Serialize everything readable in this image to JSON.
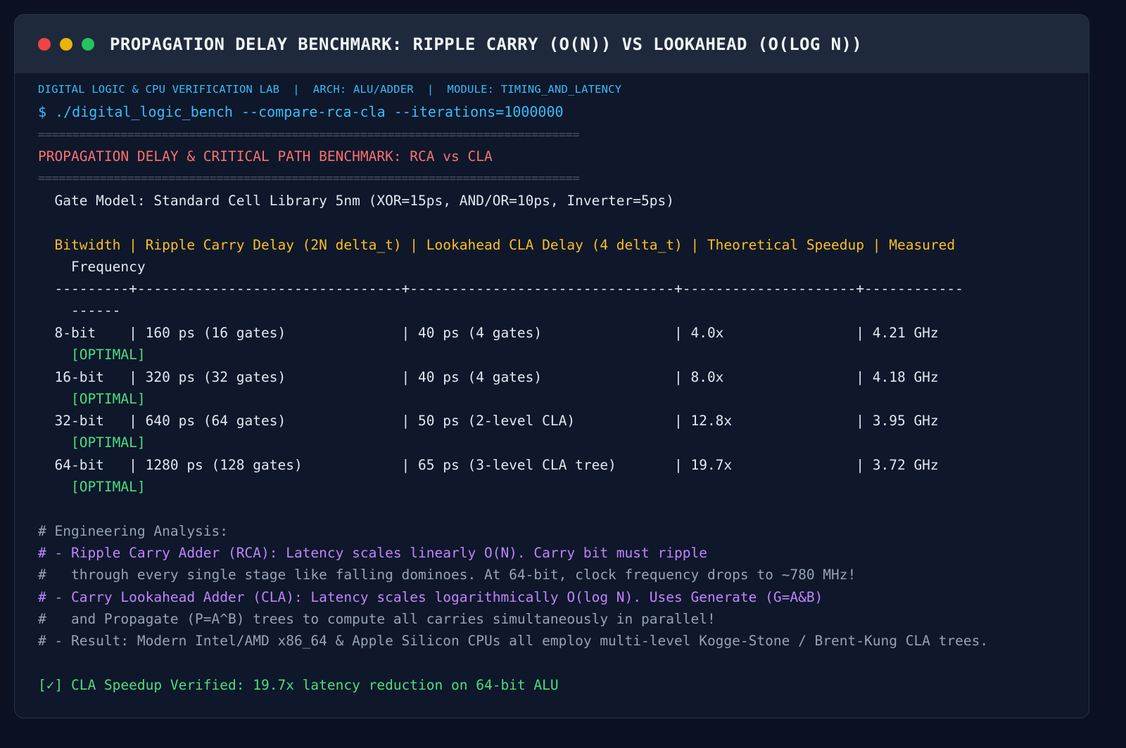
{
  "window": {
    "title": "PROPAGATION DELAY BENCHMARK: RIPPLE CARRY (O(N)) VS LOOKAHEAD (O(LOG N))"
  },
  "terminal": {
    "meta": "DIGITAL LOGIC & CPU VERIFICATION LAB  |  ARCH: ALU/ADDER  |  MODULE: TIMING_AND_LATENCY",
    "command": "$ ./digital_logic_bench --compare-rca-cla --iterations=1000000",
    "separator": "===============================================================================",
    "heading": "PROPAGATION DELAY & CRITICAL PATH BENCHMARK: RCA vs CLA",
    "gate_model": "  Gate Model: Standard Cell Library 5nm (XOR=15ps, AND/OR=10ps, Inverter=5ps)",
    "table_header_1": "  Bitwidth | Ripple Carry Delay (2N delta_t) | Lookahead CLA Delay (4 delta_t) | Theoretical Speedup | Measured",
    "table_header_2": "    Frequency",
    "table_rule_1": "  ---------+--------------------------------+--------------------------------+---------------------+------------",
    "table_rule_2": "    ------",
    "rows": [
      {
        "line": "  8-bit    | 160 ps (16 gates)              | 40 ps (4 gates)                | 4.0x                | 4.21 GHz",
        "tag": "    [OPTIMAL]"
      },
      {
        "line": "  16-bit   | 320 ps (32 gates)              | 40 ps (4 gates)                | 8.0x                | 4.18 GHz",
        "tag": "    [OPTIMAL]"
      },
      {
        "line": "  32-bit   | 640 ps (64 gates)              | 50 ps (2-level CLA)            | 12.8x               | 3.95 GHz",
        "tag": "    [OPTIMAL]"
      },
      {
        "line": "  64-bit   | 1280 ps (128 gates)            | 65 ps (3-level CLA tree)       | 19.7x               | 3.72 GHz",
        "tag": "    [OPTIMAL]"
      }
    ],
    "analysis": [
      "# Engineering Analysis:",
      "# - Ripple Carry Adder (RCA): Latency scales linearly O(N). Carry bit must ripple",
      "#   through every single stage like falling dominoes. At 64-bit, clock frequency drops to ~780 MHz!",
      "# - Carry Lookahead Adder (CLA): Latency scales logarithmically O(log N). Uses Generate (G=A&B)",
      "#   and Propagate (P=A^B) trees to compute all carries simultaneously in parallel!",
      "# - Result: Modern Intel/AMD x86_64 & Apple Silicon CPUs all employ multi-level Kogge-Stone / Brent-Kung CLA trees."
    ],
    "result": "[✓] CLA Speedup Verified: 19.7x latency reduction on 64-bit ALU"
  },
  "colors": {
    "background": "#0b1120",
    "window": "#0f172a",
    "titlebar": "#1e293b",
    "accent_blue": "#38bdf8",
    "heading_red": "#f87171",
    "header_amber": "#fbbf24",
    "ok_green": "#4ade80",
    "comment_purple": "#c084fc",
    "comment_gray": "#94a3b8"
  }
}
